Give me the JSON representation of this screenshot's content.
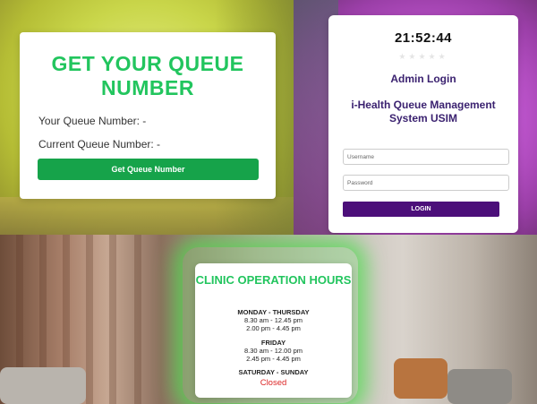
{
  "queue_panel": {
    "title": "GET YOUR QUEUE NUMBER",
    "your_queue_label": "Your Queue Number: -",
    "current_queue_label": "Current Queue Number: -",
    "button_label": "Get Queue Number"
  },
  "admin_panel": {
    "clock": "21:52:44",
    "stars": "★★★★★",
    "login_title": "Admin Login",
    "system_title": "i-Health Queue Management System USIM",
    "username_placeholder": "Username",
    "password_placeholder": "Password",
    "login_button": "LOGIN"
  },
  "hours_panel": {
    "title": "CLINIC OPERATION HOURS",
    "schedule": [
      {
        "days": "MONDAY - THURSDAY",
        "times": [
          "8.30 am - 12.45 pm",
          "2.00 pm - 4.45 pm"
        ]
      },
      {
        "days": "FRIDAY",
        "times": [
          "8.30 am - 12.00 pm",
          "2.45 pm - 4.45 pm"
        ]
      },
      {
        "days": "SATURDAY - SUNDAY",
        "times": []
      }
    ],
    "closed_label": "Closed"
  },
  "colors": {
    "green_title": "#22c55e",
    "green_button": "#16a34a",
    "purple_title": "#3b2270",
    "purple_button": "#4c0f7a",
    "closed_red": "#dc2626"
  }
}
